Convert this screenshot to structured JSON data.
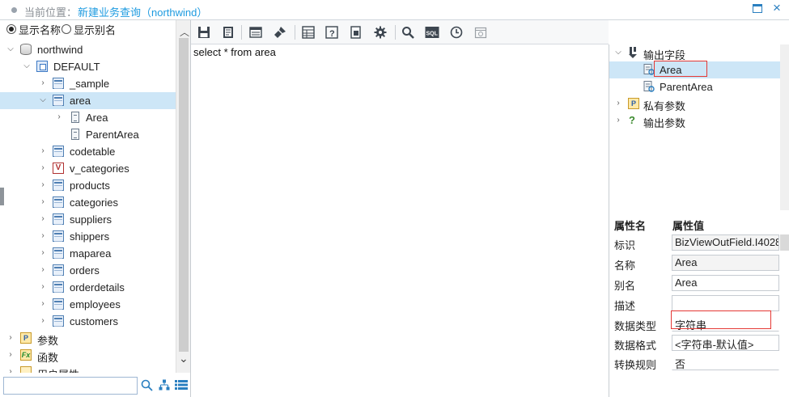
{
  "header": {
    "location_label": "当前位置：",
    "crumb": "新建业务查询（northwind）",
    "icons": [
      "maximize-icon",
      "close-icon"
    ]
  },
  "left": {
    "radio_show_name": "显示名称",
    "radio_show_alias": "显示别名",
    "radio_selected": "显示名称",
    "tree": [
      {
        "label": "northwind",
        "icon": "database-icon",
        "expanded": true
      },
      {
        "label": "DEFAULT",
        "icon": "schema-icon",
        "expanded": true
      },
      {
        "label": "_sample",
        "icon": "table-icon"
      },
      {
        "label": "area",
        "icon": "table-icon",
        "expanded": true,
        "selected": true
      },
      {
        "label": "Area",
        "icon": "field-icon"
      },
      {
        "label": "ParentArea",
        "icon": "field-icon"
      },
      {
        "label": "codetable",
        "icon": "table-icon"
      },
      {
        "label": "v_categories",
        "icon": "view-icon"
      },
      {
        "label": "products",
        "icon": "table-icon"
      },
      {
        "label": "categories",
        "icon": "table-icon"
      },
      {
        "label": "suppliers",
        "icon": "table-icon"
      },
      {
        "label": "shippers",
        "icon": "table-icon"
      },
      {
        "label": "maparea",
        "icon": "table-icon"
      },
      {
        "label": "orders",
        "icon": "table-icon"
      },
      {
        "label": "orderdetails",
        "icon": "table-icon"
      },
      {
        "label": "employees",
        "icon": "table-icon"
      },
      {
        "label": "customers",
        "icon": "table-icon"
      },
      {
        "label": "参数",
        "icon": "parameter-icon"
      },
      {
        "label": "函数",
        "icon": "function-icon"
      },
      {
        "label": "用户属性",
        "icon": "user-property-icon"
      }
    ],
    "search_placeholder": "",
    "search_icons": [
      "search-icon",
      "hierarchy-icon",
      "list-icon"
    ]
  },
  "toolbar": {
    "buttons": [
      "save-icon",
      "save-as-icon",
      "layout-icon",
      "clear-brush-icon",
      "table-view-icon",
      "help-icon",
      "export-icon",
      "settings-icon",
      "search-icon",
      "sql-icon",
      "history-icon",
      "schedule-icon"
    ],
    "sql_text": "SQL"
  },
  "editor": {
    "code": "select * from area"
  },
  "right": {
    "tree": [
      {
        "label": "输出字段",
        "icon": "output-field-icon",
        "expanded": true
      },
      {
        "label": "Area",
        "icon": "output-column-icon",
        "selected": true
      },
      {
        "label": "ParentArea",
        "icon": "output-column-icon"
      },
      {
        "label": "私有参数",
        "icon": "private-param-icon"
      },
      {
        "label": "输出参数",
        "icon": "output-param-icon"
      }
    ],
    "props_header_name": "属性名",
    "props_header_value": "属性值",
    "props": [
      {
        "name": "标识",
        "value": "BizViewOutField.I4028"
      },
      {
        "name": "名称",
        "value": "Area"
      },
      {
        "name": "别名",
        "value": "Area"
      },
      {
        "name": "描述",
        "value": ""
      },
      {
        "name": "数据类型",
        "value": "字符串"
      },
      {
        "name": "数据格式",
        "value": "<字符串-默认值>"
      },
      {
        "name": "转换规则",
        "value": "否"
      }
    ]
  },
  "colors": {
    "accent": "#1e9be0",
    "selection": "#cde6f7",
    "highlight_box": "#e53935"
  }
}
